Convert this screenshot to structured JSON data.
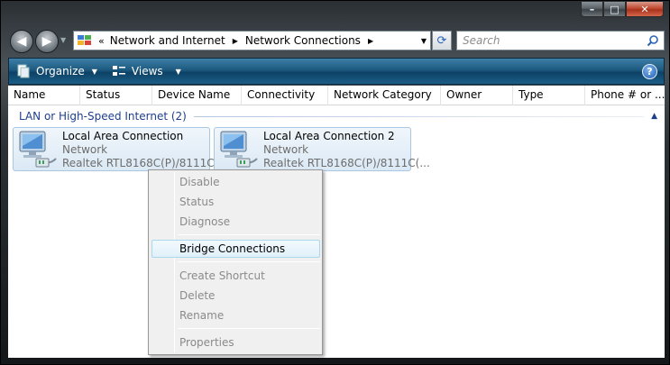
{
  "window": {
    "minimize_glyph": "–",
    "maximize_glyph": "□",
    "close_glyph": "✕"
  },
  "address_bar": {
    "overflow": "«",
    "crumbs": [
      "Network and Internet",
      "Network Connections"
    ],
    "search_placeholder": "Search"
  },
  "command_bar": {
    "organize_label": "Organize",
    "views_label": "Views",
    "help_glyph": "?"
  },
  "columns": [
    "Name",
    "Status",
    "Device Name",
    "Connectivity",
    "Network Category",
    "Owner",
    "Type",
    "Phone # or ..."
  ],
  "group": {
    "label": "LAN or High-Speed Internet (2)"
  },
  "connections": [
    {
      "name": "Local Area Connection",
      "type": "Network",
      "device": "Realtek RTL8168C(P)/8111C(..."
    },
    {
      "name": "Local Area Connection 2",
      "type": "Network",
      "device": "Realtek RTL8168C(P)/8111C(..."
    }
  ],
  "context_menu": {
    "items": [
      {
        "label": "Disable",
        "enabled": false
      },
      {
        "label": "Status",
        "enabled": false
      },
      {
        "label": "Diagnose",
        "enabled": false
      },
      {
        "label": "Bridge Connections",
        "enabled": true,
        "highlighted": true
      },
      {
        "label": "Create Shortcut",
        "enabled": false
      },
      {
        "label": "Delete",
        "enabled": false
      },
      {
        "label": "Rename",
        "enabled": false
      },
      {
        "label": "Properties",
        "enabled": false
      }
    ]
  },
  "colors": {
    "accent_text": "#1e3f8c",
    "command_bar": "#1d5a80",
    "tile_selected": "#dbe9f5",
    "disabled_text": "#8a8a8a"
  }
}
